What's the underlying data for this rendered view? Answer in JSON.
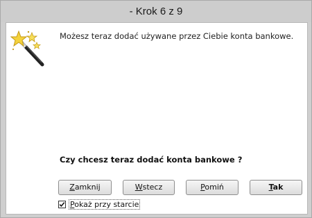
{
  "window": {
    "title": "- Krok 6 z 9"
  },
  "wizard": {
    "icon": "magic-wand-icon",
    "info_text": "Możesz teraz dodać używane przez Ciebie konta bankowe.",
    "question": "Czy chcesz teraz dodać konta bankowe ?"
  },
  "buttons": {
    "close": {
      "mnemonic": "Z",
      "rest": "amknij"
    },
    "back": {
      "mnemonic": "W",
      "rest": "stecz"
    },
    "skip": {
      "mnemonic": "P",
      "rest": "omiń"
    },
    "yes": {
      "mnemonic": "T",
      "rest": "ak"
    }
  },
  "startup": {
    "checked": true,
    "mnemonic": "P",
    "rest": "okaż przy starcie"
  },
  "colors": {
    "chrome": "#cdcdcd",
    "client_bg": "#ffffff",
    "star": "#f4d23c"
  }
}
